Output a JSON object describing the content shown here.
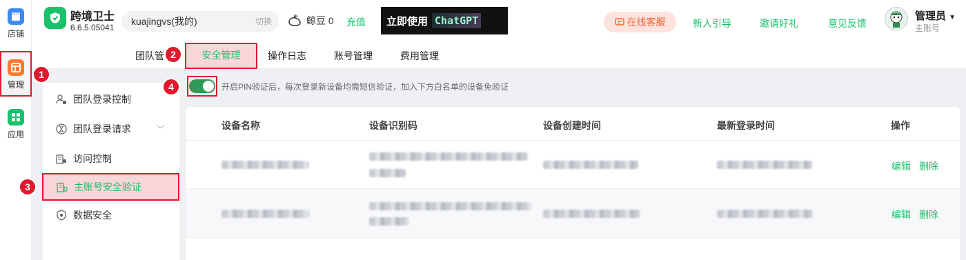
{
  "rail": {
    "store": "店铺",
    "manage": "管理",
    "apps": "应用"
  },
  "header": {
    "brand_name": "跨境卫士",
    "version": "6.6.5.05041",
    "team_name": "kuajingvs(我的)",
    "team_switch": "切换",
    "bean_label": "鲸豆 0",
    "recharge": "充值",
    "ad_text": "立即使用",
    "ad_brand": "ChatGPT",
    "service": "在线客服",
    "newbie_guide": "新人引导",
    "invite": "邀请好礼",
    "feedback": "意见反馈",
    "user_name": "管理员",
    "user_role": "主账号"
  },
  "tabs": [
    "团队管",
    "安全管理",
    "操作日志",
    "账号管理",
    "费用管理"
  ],
  "menu": [
    {
      "label": "团队登录控制"
    },
    {
      "label": "团队登录请求"
    },
    {
      "label": "访问控制"
    },
    {
      "label": "主账号安全验证"
    },
    {
      "label": "数据安全"
    }
  ],
  "pin_toggle": {
    "on": true,
    "note": "开启PIN验证后，每次登录新设备均需短信验证，加入下方白名单的设备免验证"
  },
  "table": {
    "columns": [
      "设备名称",
      "设备识别码",
      "设备创建时间",
      "最新登录时间",
      "操作"
    ],
    "actions": {
      "edit": "编辑",
      "delete": "删除"
    }
  },
  "badges": [
    "1",
    "2",
    "3",
    "4"
  ],
  "colors": {
    "accent": "#19c16b",
    "highlight": "#e0192f",
    "service": "#f06438"
  }
}
